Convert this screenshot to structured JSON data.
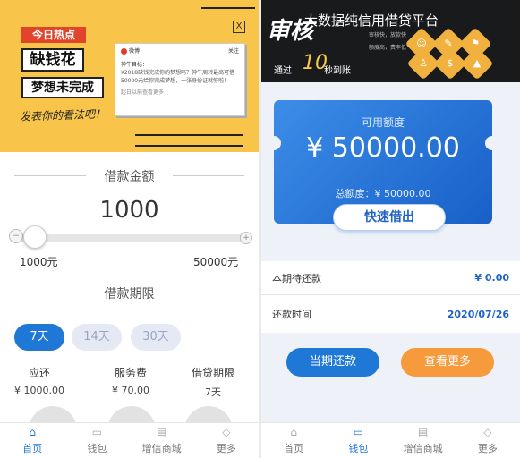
{
  "left": {
    "banner": {
      "hot_tag": "今日热点",
      "title_1": "缺钱花",
      "title_2": "梦想未完成",
      "comment": "发表你的看法吧！",
      "close": "X",
      "weibo": {
        "source": "微博",
        "follow": "关注",
        "line1": "神牛目标：",
        "line2": "¥2018缺钱完成你的梦想吗？神牛周转最高可借",
        "line3": "50000元给你完成梦想，一张身份证就够啦！",
        "footer": "超日以前查看更多"
      }
    },
    "amount": {
      "section_title": "借款金额",
      "value": "1000",
      "min_label": "1000元",
      "max_label": "50000元",
      "slider_fraction": 0,
      "minus_icon": "−",
      "plus_icon": "+"
    },
    "period": {
      "section_title": "借款期限",
      "options": [
        {
          "label": "7天",
          "active": true
        },
        {
          "label": "14天",
          "active": false
        },
        {
          "label": "30天",
          "active": false
        }
      ]
    },
    "stats": [
      {
        "label": "应还",
        "value": "¥ 1000.00"
      },
      {
        "label": "服务费",
        "value": "¥ 70.00"
      },
      {
        "label": "借贷期限",
        "value": "7天"
      }
    ],
    "tabs": [
      {
        "label": "首页",
        "icon": "home-icon",
        "active": true
      },
      {
        "label": "钱包",
        "icon": "wallet-icon",
        "active": false
      },
      {
        "label": "增信商城",
        "icon": "store-icon",
        "active": false
      },
      {
        "label": "更多",
        "icon": "more-icon",
        "active": false
      }
    ]
  },
  "right": {
    "header": {
      "brand": "审核",
      "title": "大数据纯信用借贷平台",
      "small_1": "审核快，放款快",
      "small_2": "额度高，费率低",
      "pass_text": "通过",
      "pass_number": "10",
      "pass_unit": "秒到账"
    },
    "card": {
      "label": "可用额度",
      "amount": "¥ 50000.00",
      "total": "总额度：¥ 50000.00",
      "button": "快速借出"
    },
    "info": {
      "repay_label": "本期待还款",
      "repay_value": "¥ 0.00",
      "date_label": "还款时间",
      "date_value": "2020/07/26"
    },
    "actions": {
      "repay": "当期还款",
      "more": "查看更多"
    },
    "tabs": [
      {
        "label": "首页",
        "icon": "home-icon",
        "active": false
      },
      {
        "label": "钱包",
        "icon": "wallet-icon",
        "active": true
      },
      {
        "label": "增信商城",
        "icon": "store-icon",
        "active": false
      },
      {
        "label": "更多",
        "icon": "more-icon",
        "active": false
      }
    ]
  },
  "colors": {
    "primary": "#1f78d6",
    "banner_yellow": "#f8c54a",
    "orange": "#f69a3b",
    "header_dark": "#191a1c"
  }
}
